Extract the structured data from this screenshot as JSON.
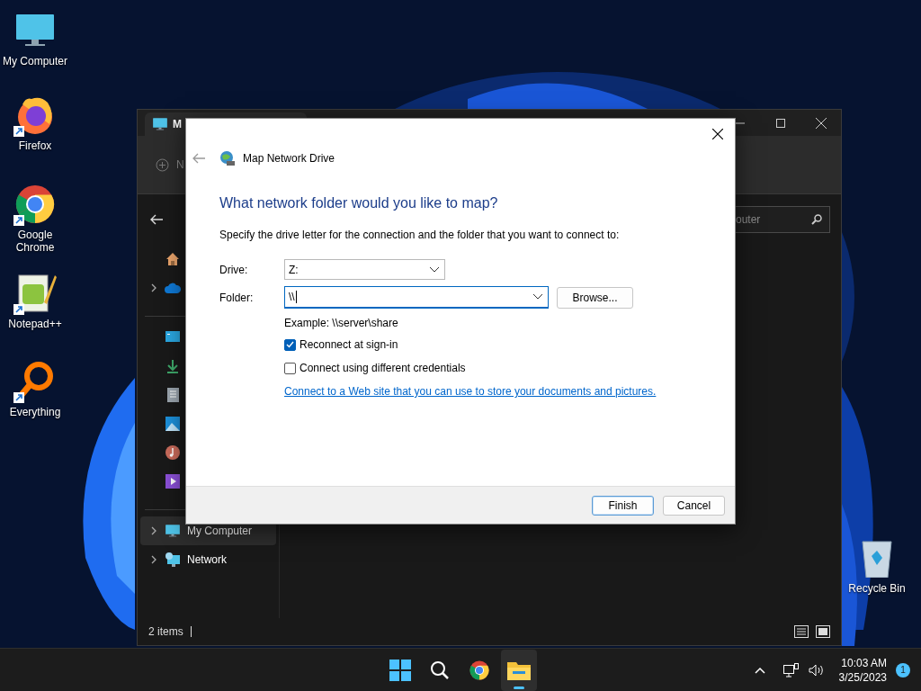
{
  "desktop_icons": [
    {
      "label": "My Computer",
      "shortcut": false
    },
    {
      "label": "Firefox",
      "shortcut": true
    },
    {
      "label": "Google Chrome",
      "shortcut": true
    },
    {
      "label": "Notepad++",
      "shortcut": true
    },
    {
      "label": "Everything",
      "shortcut": true
    }
  ],
  "recycle_bin": {
    "label": "Recycle Bin"
  },
  "explorer": {
    "tab_title": "M",
    "toolbar_button": "N",
    "search_placeholder": "outer",
    "sidebar": [
      [
        {
          "expandable": false,
          "selected": false
        },
        {
          "expandable": true,
          "selected": false
        }
      ],
      [
        {
          "expandable": false,
          "selected": false
        },
        {
          "expandable": false,
          "selected": false
        },
        {
          "expandable": false,
          "selected": false
        },
        {
          "expandable": false,
          "selected": false
        },
        {
          "expandable": false,
          "selected": false
        },
        {
          "expandable": false,
          "selected": false
        }
      ],
      [
        {
          "label": "My Computer",
          "expandable": true,
          "selected": true
        },
        {
          "label": "Network",
          "expandable": true,
          "selected": false
        }
      ]
    ],
    "status": "2 items"
  },
  "dialog": {
    "title": "Map Network Drive",
    "heading": "What network folder would you like to map?",
    "instruction": "Specify the drive letter for the connection and the folder that you want to connect to:",
    "drive": {
      "label": "Drive:",
      "value": "Z:"
    },
    "folder": {
      "label": "Folder:",
      "value": "\\\\"
    },
    "browse": "Browse...",
    "example": "Example: \\\\server\\share",
    "checkboxes": [
      {
        "label": "Reconnect at sign-in",
        "checked": true
      },
      {
        "label": "Connect using different credentials",
        "checked": false
      }
    ],
    "link": "Connect to a Web site that you can use to store your documents and pictures.",
    "buttons": [
      {
        "label": "Finish",
        "default": true
      },
      {
        "label": "Cancel",
        "default": false
      }
    ]
  },
  "taskbar": {
    "apps": [
      {
        "active": false
      },
      {
        "active": false
      },
      {
        "active": false
      },
      {
        "active": true
      }
    ],
    "time": "10:03 AM",
    "date": "3/25/2023",
    "notifications": "1"
  }
}
